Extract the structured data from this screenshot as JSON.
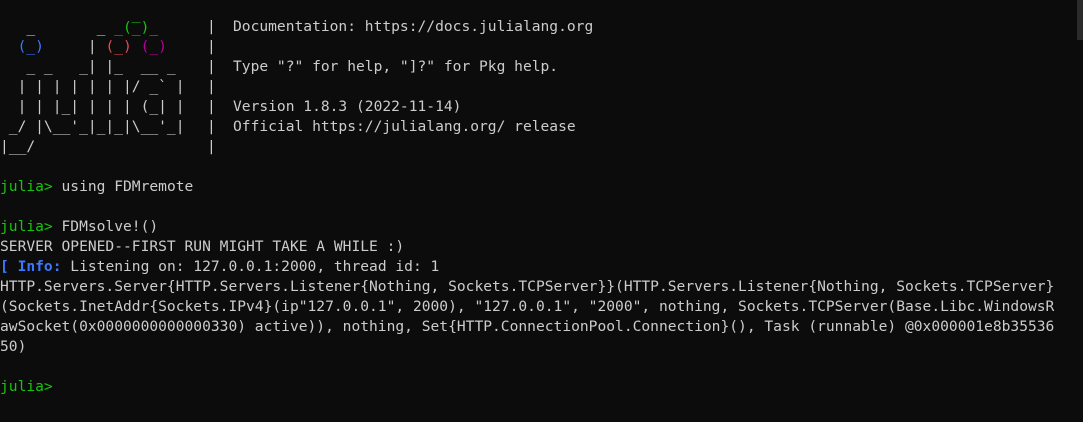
{
  "banner": {
    "logo": {
      "row0": [
        "               ",
        "_",
        "                  "
      ],
      "row1": [
        "   _       _ ",
        "_(_)_",
        "     "
      ],
      "row2": [
        "  ",
        "(_)",
        "     | ",
        "(_)",
        " ",
        "(_)",
        "    "
      ],
      "row3": "   _ _   _| |_  __ _   ",
      "row4": "  | | | | | | |/ _` |  ",
      "row5": "  | | |_| | | | (_| |  ",
      "row6": " _/ |\\__'_|_|_|\\__'_|  ",
      "row7": "|__/                   "
    },
    "separator": "|",
    "info": {
      "line0": "",
      "line1": "Documentation: https://docs.julialang.org",
      "line2": "",
      "line3": "Type \"?\" for help, \"]?\" for Pkg help.",
      "line4": "",
      "line5": "Version 1.8.3 (2022-11-14)",
      "line6": "Official https://julialang.org/ release",
      "line7": ""
    }
  },
  "session": {
    "prompt": "julia>",
    "cmd1": " using FDMremote",
    "cmd2": " FDMsolve!()",
    "out1": "SERVER OPENED--FIRST RUN MIGHT TAKE A WHILE :)",
    "info_bracket": "[ ",
    "info_label": "Info:",
    "info_text": " Listening on: 127.0.0.1:2000, thread id: 1",
    "out3": "HTTP.Servers.Server{HTTP.Servers.Listener{Nothing, Sockets.TCPServer}}(HTTP.Servers.Listener{Nothing, Sockets.TCPServer}",
    "out4": "(Sockets.InetAddr{Sockets.IPv4}(ip\"127.0.0.1\", 2000), \"127.0.0.1\", \"2000\", nothing, Sockets.TCPServer(Base.Libc.WindowsR",
    "out5": "awSocket(0x0000000000000330) active)), nothing, Set{HTTP.ConnectionPool.Connection}(), Task (runnable) @0x000001e8b35536",
    "out6": "50)"
  },
  "colors": {
    "background": "#0c0c0c",
    "text": "#cccccc",
    "prompt_green": "#16c60c",
    "info_blue": "#3b78ff",
    "logo_red": "#e74856",
    "logo_purple": "#b4009e"
  }
}
